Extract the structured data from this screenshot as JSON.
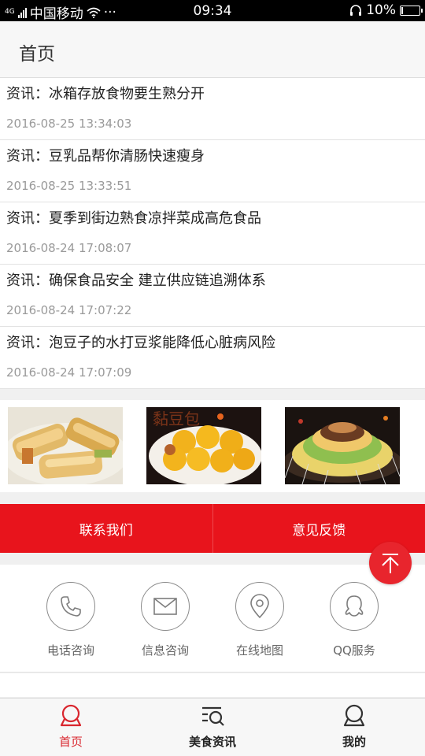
{
  "status_bar": {
    "network_label": "4G",
    "carrier": "中国移动",
    "dots": "···",
    "time": "09:34",
    "battery": "10%",
    "battery_level": 0.1
  },
  "header": {
    "title": "首页"
  },
  "news": [
    {
      "title": "资讯：冰箱存放食物要生熟分开",
      "date": "2016-08-25 13:34:03"
    },
    {
      "title": "资讯：豆乳品帮你清肠快速瘦身",
      "date": "2016-08-25 13:33:51"
    },
    {
      "title": "资讯：夏季到街边熟食凉拌菜成高危食品",
      "date": "2016-08-24 17:08:07"
    },
    {
      "title": "资讯：确保食品安全 建立供应链追溯体系",
      "date": "2016-08-24 17:07:22"
    },
    {
      "title": "资讯：泡豆子的水打豆浆能降低心脏病风险",
      "date": "2016-08-24 17:07:09"
    }
  ],
  "images": [
    {
      "name": "food-image-rolls"
    },
    {
      "name": "food-image-buns",
      "caption": "黏豆包"
    },
    {
      "name": "food-image-skewers"
    }
  ],
  "actions": {
    "contact": "联系我们",
    "feedback": "意见反馈"
  },
  "services": [
    {
      "label": "电话咨询",
      "icon": "phone-icon"
    },
    {
      "label": "信息咨询",
      "icon": "mail-icon"
    },
    {
      "label": "在线地图",
      "icon": "map-pin-icon"
    },
    {
      "label": "QQ服务",
      "icon": "qq-icon"
    }
  ],
  "nav": {
    "home": "首页",
    "food_news": "美食资讯",
    "mine": "我的"
  },
  "colors": {
    "accent": "#e8141c",
    "active_nav": "#d9262e"
  }
}
